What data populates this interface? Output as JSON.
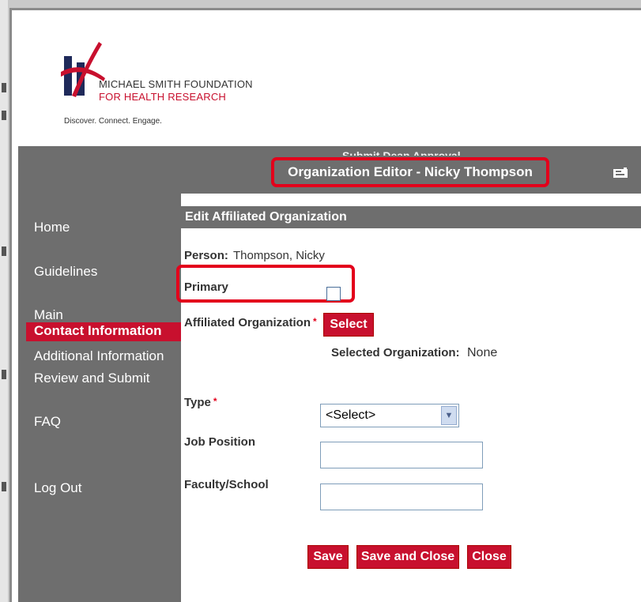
{
  "logo": {
    "line1": "MICHAEL SMITH FOUNDATION",
    "line2": "FOR HEALTH RESEARCH",
    "tagline": "Discover. Connect. Engage."
  },
  "band": {
    "subtitle": "Submit Dean Approval",
    "title": "Organization Editor  -  Nicky Thompson"
  },
  "nav": {
    "home": "Home",
    "guidelines": "Guidelines",
    "main": "Main",
    "contact": "Contact Information",
    "additional": "Additional Information",
    "review": "Review and Submit",
    "faq": "FAQ",
    "logout": "Log Out"
  },
  "form": {
    "section_title": "Edit Affiliated Organization",
    "person_label": "Person:",
    "person_value": "Thompson, Nicky",
    "primary_label": "Primary",
    "primary_checked": false,
    "affiliated_label": "Affiliated Organization",
    "required_mark": "*",
    "select_button": "Select",
    "selected_org_label": "Selected Organization:",
    "selected_org_value": "None",
    "type_label": "Type",
    "type_value": "<Select>",
    "job_label": "Job Position",
    "job_value": "",
    "faculty_label": "Faculty/School",
    "faculty_value": ""
  },
  "actions": {
    "save": "Save",
    "save_close": "Save and Close",
    "close": "Close"
  },
  "colors": {
    "brand_red": "#c8102e",
    "highlight_red": "#e3001b",
    "sidebar_gray": "#6e6e6e"
  }
}
